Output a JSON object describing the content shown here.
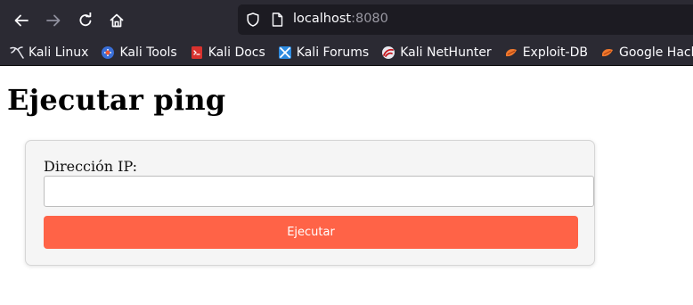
{
  "browser": {
    "url_host": "localhost",
    "url_port": ":8080",
    "nav_icons": [
      "back-arrow-icon",
      "forward-arrow-icon",
      "reload-icon",
      "home-icon"
    ],
    "urlbar_icons": [
      "tracking-shield-icon",
      "page-info-icon"
    ],
    "theme_colors": {
      "toolbar": "#2b2a33",
      "urlbar": "#1c1b22",
      "text": "#fbfbfe"
    }
  },
  "bookmarks": [
    {
      "label": "Kali Linux",
      "icon": "kali-dragon-icon"
    },
    {
      "label": "Kali Tools",
      "icon": "kali-tools-icon"
    },
    {
      "label": "Kali Docs",
      "icon": "kali-docs-icon"
    },
    {
      "label": "Kali Forums",
      "icon": "kali-forums-icon"
    },
    {
      "label": "Kali NetHunter",
      "icon": "kali-nethunter-icon"
    },
    {
      "label": "Exploit-DB",
      "icon": "exploit-db-icon"
    },
    {
      "label": "Google Hacking DB",
      "icon": "google-hacking-db-icon"
    }
  ],
  "page": {
    "title": "Ejecutar ping",
    "form": {
      "ip_label": "Dirección IP:",
      "ip_value": "",
      "submit_label": "Ejecutar",
      "button_color": "#ff6347"
    }
  }
}
